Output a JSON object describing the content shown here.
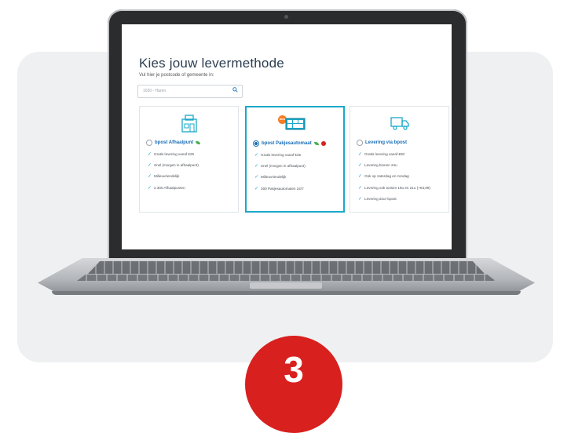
{
  "page": {
    "step_number": "3"
  },
  "screen": {
    "title": "Kies jouw levermethode",
    "subtitle": "Vul hier je postcode of gemeente in:",
    "search": {
      "placeholder": "1030 - Haren"
    },
    "options": [
      {
        "title": "bpost Afhaalpunt",
        "selected": false,
        "icon": "pickup-point-icon",
        "features": [
          "Gratis levering vanaf €25",
          "Snel (morgen in afhaalpunt)",
          "Milieuvriendelijk",
          "2.300 Afhaalpunten"
        ]
      },
      {
        "title": "bpost Pakjesautomaat",
        "selected": true,
        "badge": "New",
        "icon": "parcel-locker-icon",
        "features": [
          "Gratis levering vanaf €25",
          "Snel (morgen in afhaalpunt)",
          "Milieuvriendelijk",
          "300 Pakjesautomaten 24/7"
        ]
      },
      {
        "title": "Levering via bpost",
        "selected": false,
        "icon": "delivery-truck-icon",
        "features": [
          "Gratis levering vanaf €50",
          "Levering binnen 24u",
          "Ook op zaterdag en zondag",
          "Levering ook tussen 18u en 21u (+€3,99)",
          "Levering door bpost"
        ]
      }
    ]
  },
  "colors": {
    "accent": "#19a9c9",
    "link": "#1a6eb8",
    "step": "#d8201f",
    "panel": "#eef0f1"
  }
}
